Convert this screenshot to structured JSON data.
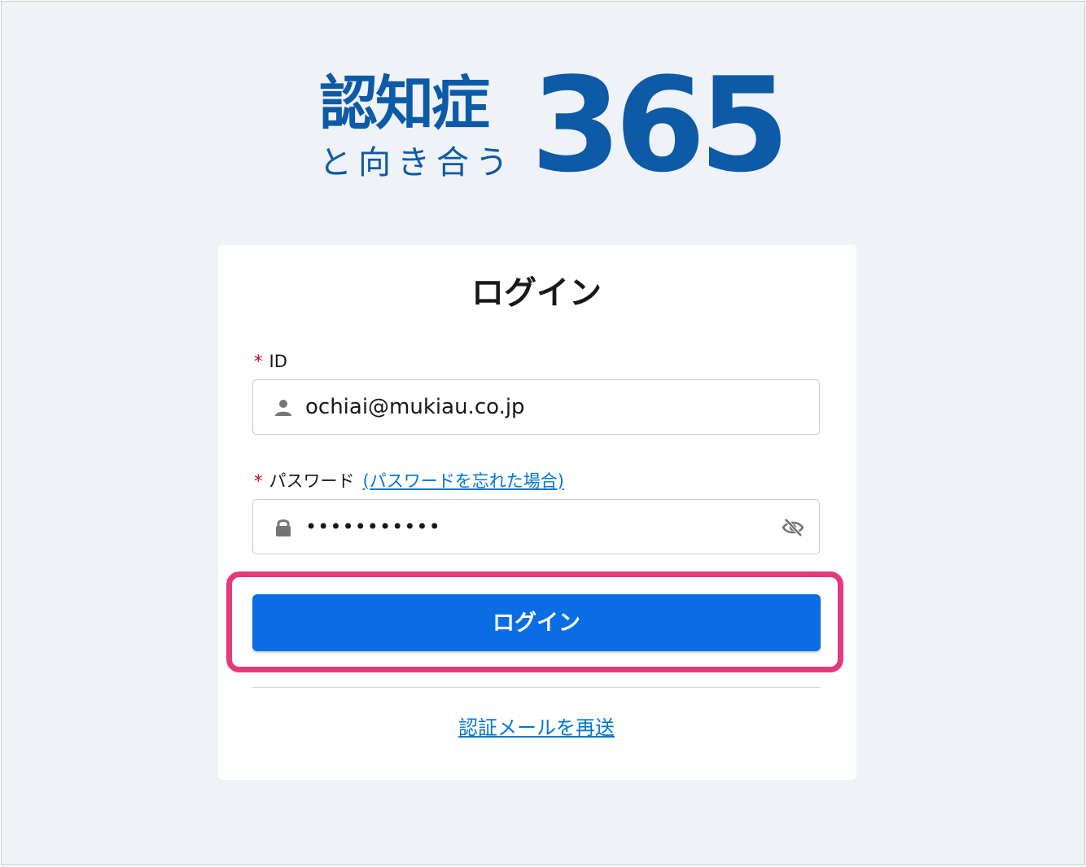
{
  "colors": {
    "page_background": "#eff2f7",
    "logo_blue": "#0d5aa6",
    "primary_button": "#0b6de3",
    "link": "#0176d3",
    "required_marker": "#ba0517",
    "highlight_frame": "#e6397c"
  },
  "logo": {
    "main_text": "認知症",
    "sub_text": "と向き合う",
    "number_text": "365"
  },
  "login_card": {
    "title": "ログイン",
    "id_field": {
      "required_marker": "*",
      "label": "ID",
      "value": "ochiai@mukiau.co.jp",
      "leading_icon": "user-icon"
    },
    "password_field": {
      "required_marker": "*",
      "label": "パスワード",
      "forgot_link": "(パスワードを忘れた場合)",
      "value": "•••••••••••",
      "leading_icon": "lock-icon",
      "trailing_icon": "eye-slash-icon"
    },
    "login_button": "ログイン",
    "resend_link": "認証メールを再送"
  }
}
